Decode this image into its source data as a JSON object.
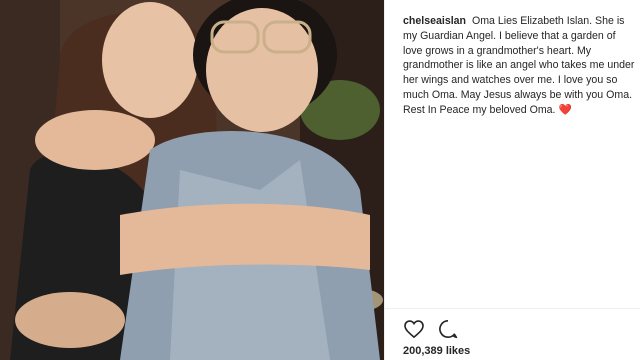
{
  "post": {
    "username": "chelseaislan",
    "caption": "Oma Lies Elizabeth Islan. She is my Guardian Angel. I believe that a garden of love grows in a grandmother's heart. My grandmother is like an angel who takes me under her wings and watches over me. I love you so much Oma. May Jesus always be with you Oma. Rest In Peace my beloved Oma. ❤️",
    "likes_text": "200,389 likes"
  },
  "icons": {
    "like": "heart-icon",
    "comment": "comment-icon"
  },
  "colors": {
    "text": "#262626",
    "border": "#efefef",
    "background": "#ffffff"
  }
}
